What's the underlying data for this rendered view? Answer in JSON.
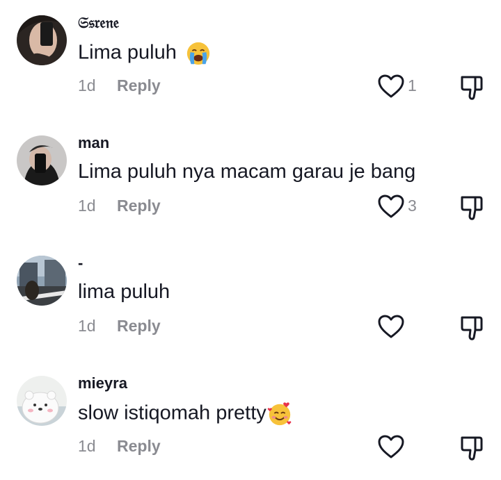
{
  "comments": [
    {
      "username": "𝔖𝔰𝔯𝔢𝔫𝔢",
      "text": "Lima puluh ",
      "emoji": "loudly-crying-face-icon",
      "time": "1d",
      "reply_label": "Reply",
      "like_count": "1"
    },
    {
      "username": "man",
      "text": "Lima puluh nya macam garau je bang",
      "time": "1d",
      "reply_label": "Reply",
      "like_count": "3"
    },
    {
      "username": "-",
      "text": "lima puluh",
      "time": "1d",
      "reply_label": "Reply",
      "like_count": ""
    },
    {
      "username": "mieyra",
      "text": "slow istiqomah pretty",
      "emoji": "smiling-face-with-hearts-icon",
      "time": "1d",
      "reply_label": "Reply",
      "like_count": ""
    }
  ],
  "colors": {
    "primary_text": "#161823",
    "secondary_text": "#8a8b91"
  }
}
